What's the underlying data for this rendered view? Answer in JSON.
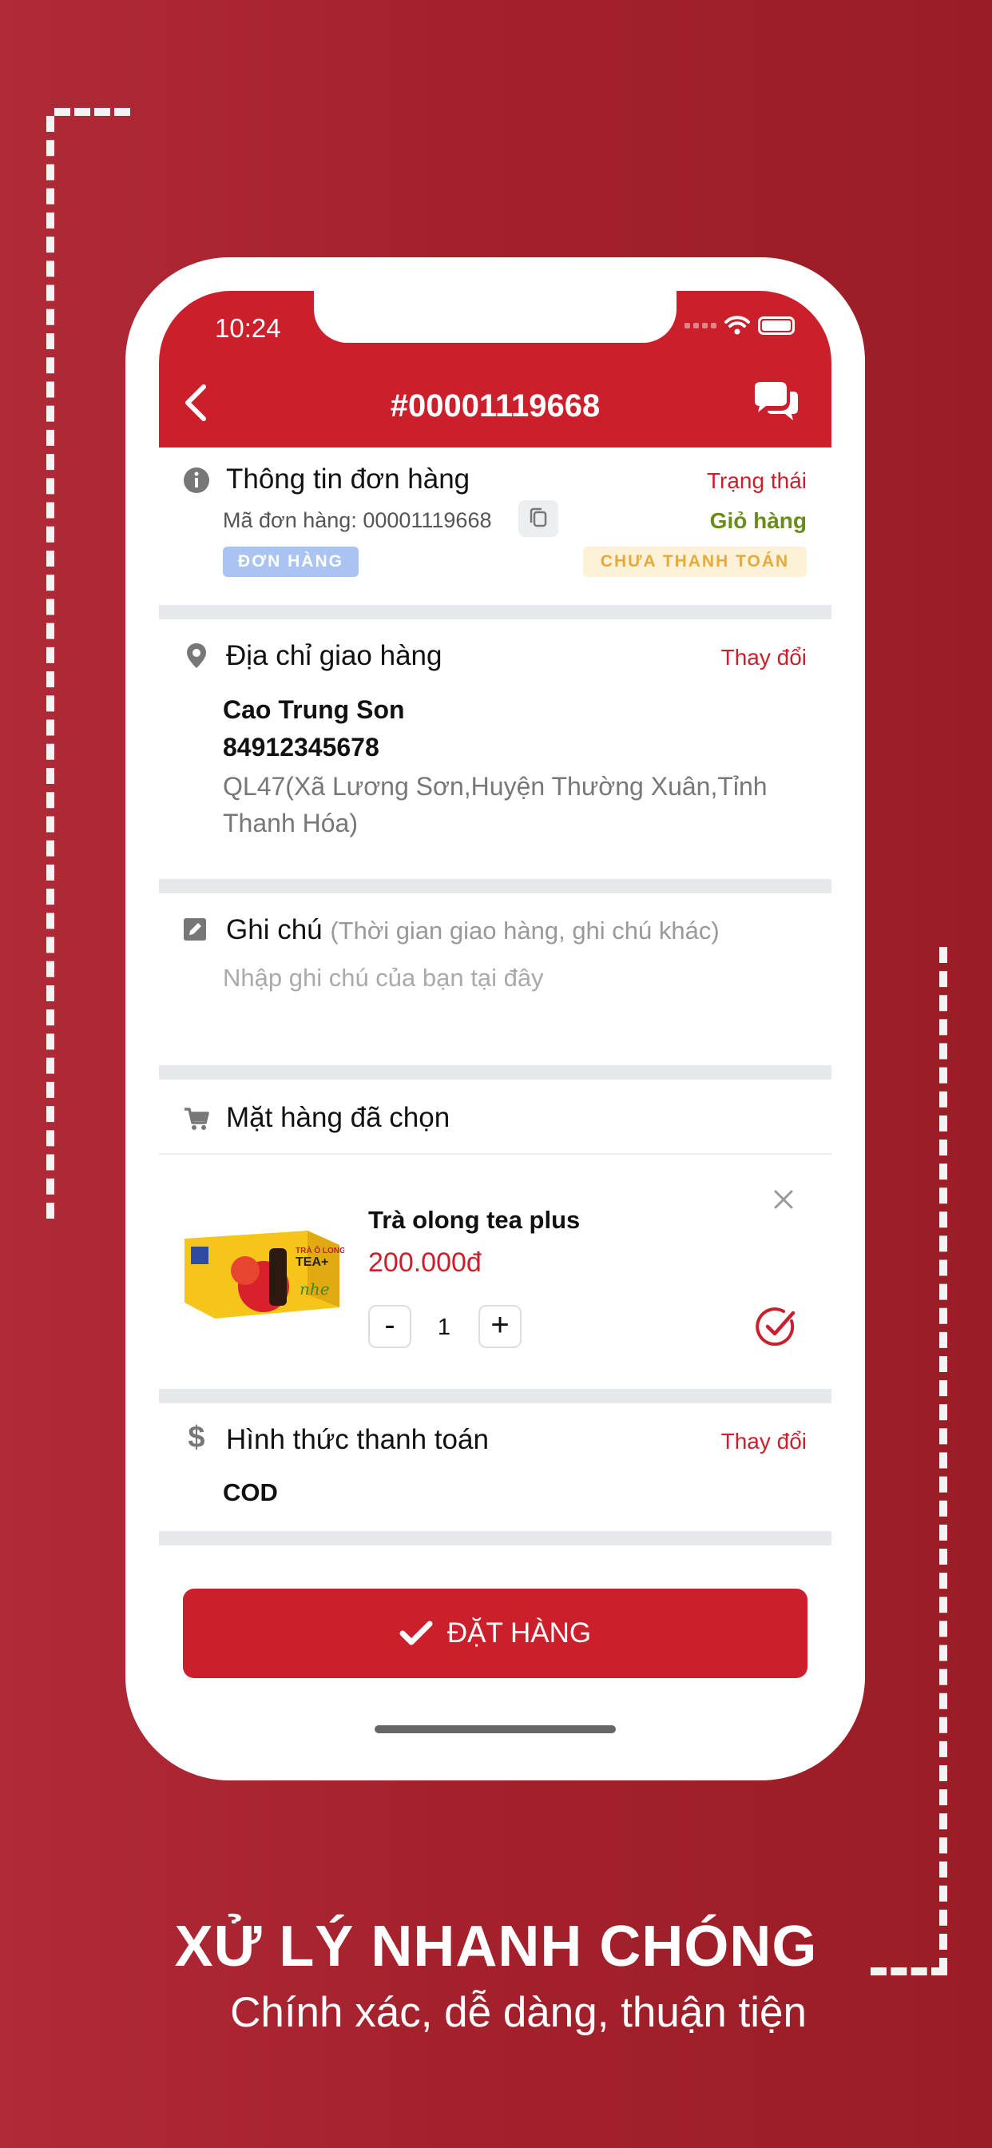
{
  "statusbar": {
    "time": "10:24"
  },
  "header": {
    "title": "#00001119668"
  },
  "order_info": {
    "title": "Thông tin đơn hàng",
    "status_label": "Trạng thái",
    "code_text": "Mã đơn hàng: 00001119668",
    "status_value": "Giỏ hàng",
    "badge_type": "ĐƠN HÀNG",
    "badge_payment": "CHƯA THANH TOÁN"
  },
  "address": {
    "title": "Địa chỉ giao hàng",
    "change": "Thay đổi",
    "name": "Cao Trung Son",
    "phone": "84912345678",
    "line1": "QL47(Xã Lương Sơn,Huyện Thường Xuân,Tỉnh",
    "line2": "Thanh Hóa)"
  },
  "note": {
    "title": "Ghi chú",
    "hint": "(Thời gian giao hàng, ghi chú khác)",
    "placeholder": "Nhập ghi chú của bạn tại đây"
  },
  "items": {
    "title": "Mặt hàng đã chọn",
    "product": {
      "name": "Trà olong tea plus",
      "price": "200.000đ",
      "quantity": "1",
      "minus": "-",
      "plus": "+"
    }
  },
  "payment": {
    "title": "Hình thức thanh toán",
    "change": "Thay đổi",
    "method": "COD"
  },
  "actions": {
    "order_label": "ĐẶT HÀNG"
  },
  "promo": {
    "headline": "XỬ LÝ NHANH CHÓNG",
    "subline": "Chính xác, dễ dàng, thuận tiện"
  },
  "colors": {
    "brand_red": "#cc1f2c",
    "status_green": "#6a8c1c",
    "badge_blue": "#a9c4f0",
    "badge_amber": "#e6a93a"
  }
}
